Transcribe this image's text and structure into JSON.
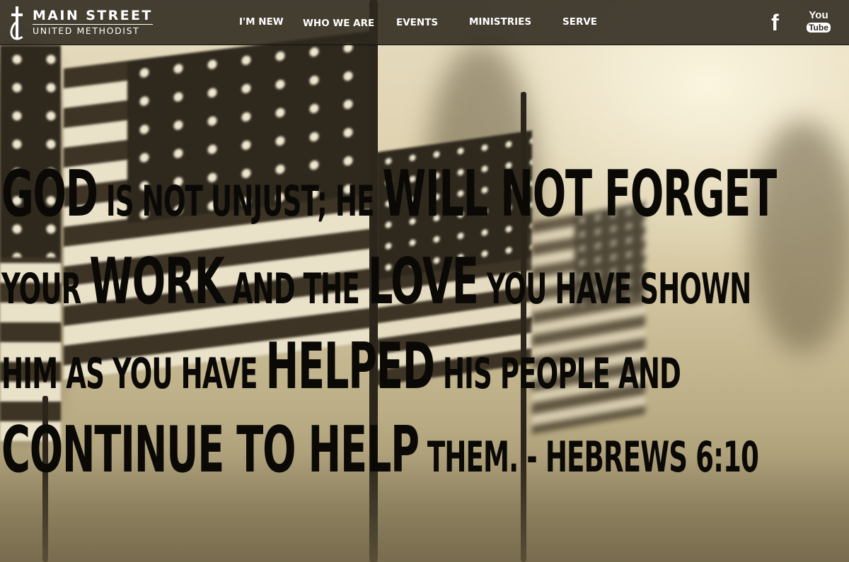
{
  "brand": {
    "line1": "MAIN STREET",
    "line2": "UNITED METHODIST",
    "logo_icon": "cross-and-flame-icon"
  },
  "nav": {
    "items": [
      {
        "label": "I'M NEW"
      },
      {
        "label": "WHO WE ARE"
      },
      {
        "label": "EVENTS"
      },
      {
        "label": "MINISTRIES"
      },
      {
        "label": "SERVE"
      }
    ]
  },
  "social": {
    "facebook": "f",
    "youtube_top": "You",
    "youtube_bottom": "Tube"
  },
  "hero": {
    "background": "sepia-american-flags-photo",
    "verse": {
      "line1": [
        {
          "text": "GOD",
          "size": "big"
        },
        {
          "text": " IS NOT UNJUST; HE ",
          "size": "sm"
        },
        {
          "text": "WILL NOT FORGET",
          "size": "big"
        }
      ],
      "line2": [
        {
          "text": "YOUR ",
          "size": "sm"
        },
        {
          "text": "WORK",
          "size": "big"
        },
        {
          "text": " AND THE ",
          "size": "sm"
        },
        {
          "text": "LOVE",
          "size": "big"
        },
        {
          "text": " YOU HAVE SHOWN",
          "size": "sm"
        }
      ],
      "line3": [
        {
          "text": "HIM AS YOU HAVE ",
          "size": "sm"
        },
        {
          "text": "HELPED",
          "size": "big"
        },
        {
          "text": " HIS PEOPLE",
          "size": "sm"
        },
        {
          "text": " AND",
          "size": "sm"
        }
      ],
      "line4": [
        {
          "text": "CONTINUE TO HELP",
          "size": "big"
        },
        {
          "text": " THEM. - ",
          "size": "sm"
        },
        {
          "text": "HEBREWS 6:10",
          "size": "sm"
        }
      ]
    }
  },
  "colors": {
    "nav_bg": "#2e281d",
    "verse_text": "#0b0906",
    "sepia_light": "#e7dcc0"
  }
}
